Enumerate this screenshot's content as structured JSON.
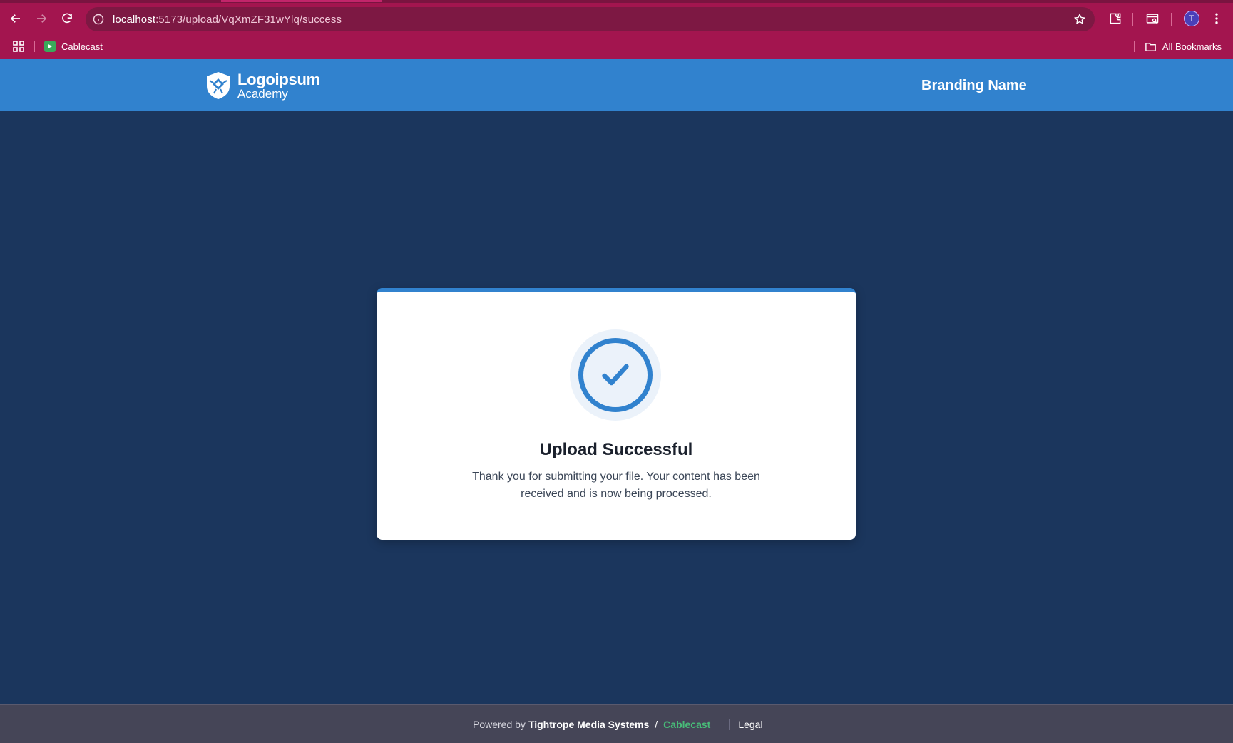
{
  "browser": {
    "url_host": "localhost",
    "url_path": ":5173/upload/VqXmZF31wYlq/success",
    "profile_initial": "T",
    "bookmark": "Cablecast",
    "all_bookmarks": "All Bookmarks",
    "theme_color": "#a3154f"
  },
  "header": {
    "logo_title": "Logoipsum",
    "logo_subtitle": "Academy",
    "brand_name": "Branding Name",
    "color": "#3182ce"
  },
  "card": {
    "title": "Upload Successful",
    "message": "Thank you for submitting your file. Your content has been received and is now being processed.",
    "icon": "check-circle-icon"
  },
  "footer": {
    "powered_by": "Powered by",
    "company": "Tightrope Media Systems",
    "separator": "/",
    "product": "Cablecast",
    "legal": "Legal",
    "accent": "#48bb78"
  }
}
